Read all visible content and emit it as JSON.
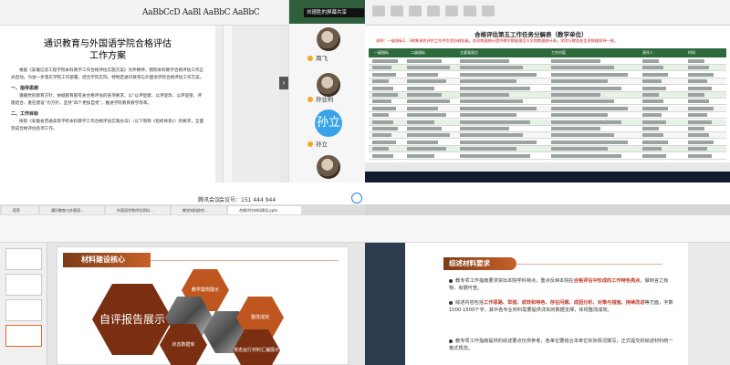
{
  "meeting": {
    "title": "腾讯会议",
    "id_label": "会议号：151 444 944"
  },
  "q1": {
    "toolbar_styles": "AaBbCcD AaBl AaBbC AaBbC",
    "doc_title_line1": "通识教育与外国语学院合格评估",
    "doc_title_line2": "工作方案",
    "paragraphs": [
      "根据《安徽信息工程学院本科教学工作合格评估实施方案》文件精神，我院本科教学合格评估工作正式启动。为进一步落实学院工作部署，结合学院实际，特制定通识教育与外国语学院合格评估工作方案。",
      "一、指导思想"
    ],
    "heading_1": "一、指导思想",
    "para_2": "遵循党的教育方针，依据教育部有关合格评估的各项要求，以“以评促建、以评促改、以评促管、评建结合、重在建设”为方针，坚持“四个更加自觉”，推进学院教育教学改革。",
    "heading_2": "二、工作目标",
    "para_3": "按照《安徽省普通高等学校本科教学工作合格评估实施办法》（以下简称《指标体系》）的要求，全面完成合格评估各项工作。",
    "participants": [
      {
        "name": "刘德胜的屏幕共享"
      },
      {
        "name": "周飞"
      },
      {
        "name": "孙业利"
      },
      {
        "name": "孙立"
      }
    ],
    "blue_avatar_text": "孙立"
  },
  "q2": {
    "sheet_title": "合格评估第五工作任务分解表（教学单位）",
    "note": "说明：一级指标2、3统筹调控评估工作并负责协调各级，各项数据统计提供教学数据规范与学院数据统计表。学院与教务处信息数据保持一致。",
    "headers": [
      "一级指标",
      "二级指标",
      "主要观测点",
      "工作内容",
      "责任人",
      "时间"
    ]
  },
  "q3": {
    "tabs": [
      "稻壳",
      "通识教育与外国语...",
      "外国语学院评估资料...",
      "教学材料综合...",
      "合格评估材料建设.pptx"
    ],
    "banner": "材料建设核心",
    "hex_center": "自评报告展示",
    "hex_labels": [
      "教学案例展示",
      "状态数据库",
      "整改成效",
      "常态运行材料汇编展示"
    ]
  },
  "q4": {
    "banner": "综述材料要求",
    "bullets": [
      {
        "pre": "教专项工作指南要求突出本院学科特点，重点反映本院在",
        "hl": "合格评估中形成的工作特色亮点",
        "post": "，做到言之有物、有据可查。"
      },
      {
        "pre": "综述内容包括",
        "hl": "工作思路、举措、成效和特色、存在问题、成因分析、对策与措施、持续改进",
        "post": "等方面，字数1000-1500个字，其中各专业材料需要提供详实的数据支撑，体现整改成效。"
      },
      {
        "pre": "教专项工作指南提供的综述要点仅供参考，各单位要结合本单位实际情况撰写，正式提交的综述材料统一格式规范。",
        "hl": "",
        "post": ""
      }
    ]
  }
}
